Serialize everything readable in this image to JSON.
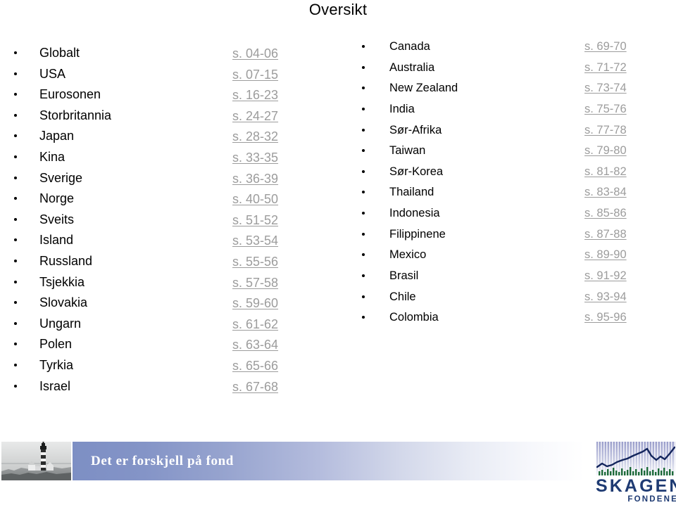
{
  "slide": {
    "title": "Oversikt"
  },
  "toc": {
    "left_column": [
      {
        "label": "Globalt",
        "pages": "s. 04-06"
      },
      {
        "label": "USA",
        "pages": "s. 07-15"
      },
      {
        "label": "Eurosonen",
        "pages": "s. 16-23"
      },
      {
        "label": "Storbritannia",
        "pages": "s. 24-27"
      },
      {
        "label": "Japan",
        "pages": "s. 28-32"
      },
      {
        "label": "Kina",
        "pages": "s. 33-35"
      },
      {
        "label": "Sverige",
        "pages": "s. 36-39"
      },
      {
        "label": "Norge",
        "pages": "s. 40-50"
      },
      {
        "label": "Sveits",
        "pages": "s. 51-52"
      },
      {
        "label": "Island",
        "pages": "s. 53-54"
      },
      {
        "label": "Russland",
        "pages": "s. 55-56"
      },
      {
        "label": "Tsjekkia",
        "pages": "s. 57-58"
      },
      {
        "label": "Slovakia",
        "pages": "s. 59-60"
      },
      {
        "label": "Ungarn",
        "pages": "s. 61-62"
      },
      {
        "label": "Polen",
        "pages": "s. 63-64"
      },
      {
        "label": "Tyrkia",
        "pages": "s. 65-66"
      },
      {
        "label": "Israel",
        "pages": "s. 67-68"
      }
    ],
    "right_column": [
      {
        "label": "Canada",
        "pages": "s. 69-70"
      },
      {
        "label": "Australia",
        "pages": "s. 71-72"
      },
      {
        "label": "New Zealand",
        "pages": "s. 73-74"
      },
      {
        "label": "India",
        "pages": "s. 75-76"
      },
      {
        "label": "Sør-Afrika",
        "pages": "s. 77-78"
      },
      {
        "label": "Taiwan",
        "pages": "s. 79-80"
      },
      {
        "label": "Sør-Korea",
        "pages": "s. 81-82"
      },
      {
        "label": "Thailand",
        "pages": "s. 83-84"
      },
      {
        "label": "Indonesia",
        "pages": "s. 85-86"
      },
      {
        "label": "Filippinene",
        "pages": "s. 87-88"
      },
      {
        "label": "Mexico",
        "pages": "s. 89-90"
      },
      {
        "label": "Brasil",
        "pages": "s. 91-92"
      },
      {
        "label": "Chile",
        "pages": "s. 93-94"
      },
      {
        "label": "Colombia",
        "pages": "s. 95-96"
      }
    ]
  },
  "footer": {
    "tagline": "Det er forskjell på fond",
    "logo": {
      "wordmark": "SKAGEN",
      "subword": "FONDENE"
    },
    "photo_alt": "lighthouse-photo"
  },
  "colors": {
    "tagline_bar_start": "#7d8fc4",
    "tagline_bar_end": "#ffffff",
    "logo_navy": "#1f3b73",
    "logo_green": "#1e6b3a",
    "page_link_grey": "#9c9c9c",
    "text_black": "#000000",
    "background": "#ffffff"
  }
}
